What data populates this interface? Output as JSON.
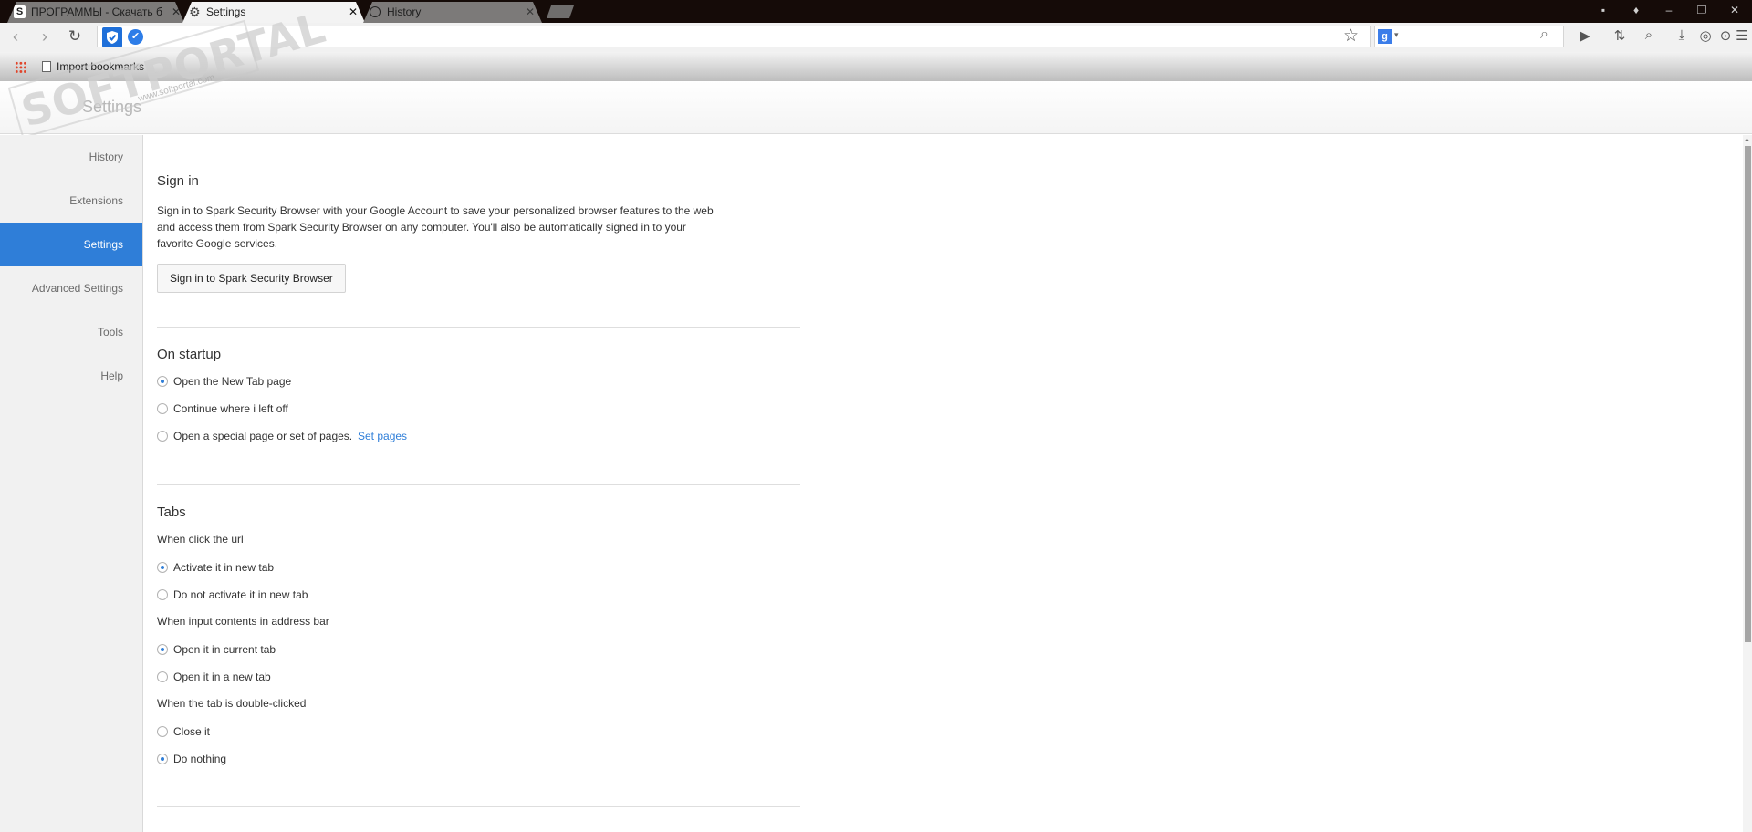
{
  "tabs": [
    {
      "title": "ПРОГРАММЫ - Скачать б",
      "icon": "softportal-favicon",
      "active": false
    },
    {
      "title": "Settings",
      "icon": "gear-icon",
      "active": true
    },
    {
      "title": "History",
      "icon": "clock-icon",
      "active": false
    }
  ],
  "bookmarks": {
    "import_label": "Import bookmarks"
  },
  "header": {
    "title": "Settings"
  },
  "watermark": {
    "brand": "SOFTPORTAL",
    "url": "www.softportal.com"
  },
  "sidebar": {
    "items": [
      {
        "label": "History",
        "active": false
      },
      {
        "label": "Extensions",
        "active": false
      },
      {
        "label": "Settings",
        "active": true
      },
      {
        "label": "Advanced Settings",
        "active": false
      },
      {
        "label": "Tools",
        "active": false
      },
      {
        "label": "Help",
        "active": false
      }
    ]
  },
  "signin": {
    "title": "Sign in",
    "line1": "Sign in to Spark Security Browser with your Google Account to save your personalized browser features to the web",
    "line2": "and access them from Spark Security Browser on any computer. You'll also be automatically signed in to your",
    "line3": "favorite Google services.",
    "button": "Sign in to Spark Security Browser"
  },
  "startup": {
    "title": "On startup",
    "options": [
      {
        "label": "Open the New Tab page",
        "checked": true
      },
      {
        "label": "Continue where i left off",
        "checked": false
      },
      {
        "label": "Open a special page or set of pages.",
        "checked": false
      }
    ],
    "set_pages": "Set pages"
  },
  "tabs_section": {
    "title": "Tabs",
    "click_url_label": "When click the url",
    "click_url_options": [
      {
        "label": "Activate it in new tab",
        "checked": true
      },
      {
        "label": "Do not activate it in new tab",
        "checked": false
      }
    ],
    "address_bar_label": "When input contents in address bar",
    "address_bar_options": [
      {
        "label": "Open it in current tab",
        "checked": true
      },
      {
        "label": "Open it in a new tab",
        "checked": false
      }
    ],
    "double_click_label": "When the tab is double-clicked",
    "double_click_options": [
      {
        "label": "Close it",
        "checked": false
      },
      {
        "label": "Do nothing",
        "checked": true
      }
    ]
  },
  "colors": {
    "accent": "#2f7ed8",
    "tabstrip": "#150b08",
    "sidebar": "#f1f1f1"
  }
}
